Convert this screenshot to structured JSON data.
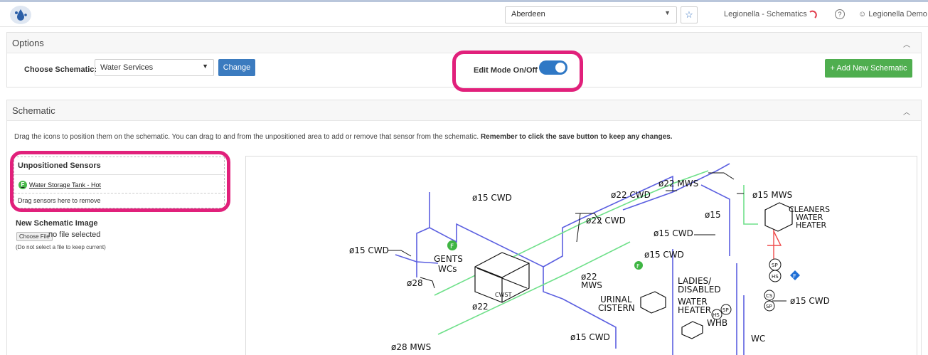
{
  "topbar": {
    "site": "Aberdeen",
    "breadcrumb": "Legionella - Schematics",
    "user": "Legionella Demo"
  },
  "options": {
    "title": "Options",
    "choose_label": "Choose Schematic:",
    "selected_schematic": "Water Services",
    "change_label": "Change",
    "edit_mode_label": "Edit Mode On/Off",
    "edit_mode_on": true,
    "add_label": "+ Add New Schematic"
  },
  "schematic": {
    "title": "Schematic",
    "instructions": "Drag the icons to position them on the schematic. You can drag to and from the unpositioned area to add or remove that sensor from the schematic.",
    "instructions_bold": "Remember to click the save button to keep any changes.",
    "unpositioned_title": "Unpositioned Sensors",
    "sensor_name": "Water Storage Tank - Hot",
    "sensor_badge": "F",
    "drop_hint": "Drag sensors here to remove",
    "new_image_title": "New Schematic Image",
    "choose_file": "Choose File",
    "no_file": "no file selected",
    "keep_hint": "(Do not select a file to keep current)"
  },
  "drawing_labels": {
    "l1": "ø15  CWD",
    "l2": "ø22  MWS",
    "l3": "ø22  CWD",
    "l4": "ø15  MWS",
    "l5": "ø15",
    "l6": "CLEANERS",
    "l7": "WATER",
    "l8": "HEATER",
    "l9": "ø22  CWD",
    "l10": "ø15  CWD",
    "l11": "ø15  CWD",
    "l12": "ø15  CWD",
    "l13": "GENTS",
    "l14": "WCs",
    "l15": "ø28",
    "l16": "CWST",
    "l17": "ø22",
    "l18": "ø22",
    "l19": "MWS",
    "l20": "URINAL",
    "l21": "CISTERN",
    "l22": "LADIES/",
    "l23": "DISABLED",
    "l24": "WATER",
    "l25": "HEATER",
    "l26": "WHB",
    "l27": "ø15  CWD",
    "l28": "WC",
    "l29": "ø15  CWD",
    "l30": "ø28  MWS",
    "l31": "SP",
    "l32": "HS",
    "l33": "CS",
    "l34": "SP",
    "l35": "HS",
    "l36": "SP",
    "l37": "F",
    "l38": "F",
    "l39": "F"
  },
  "colors": {
    "accent": "#2f78c5",
    "success": "#4fae4f",
    "highlight": "#e1207b",
    "cold_pipe": "#5b5fe0",
    "mixed_pipe": "#6fe08a",
    "hot_pipe": "#ef4a4a"
  }
}
